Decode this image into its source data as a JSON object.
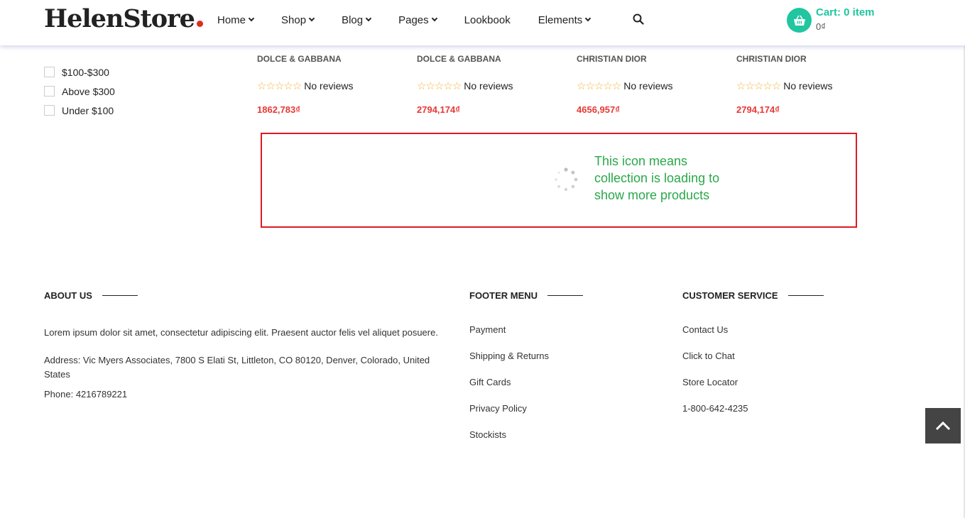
{
  "header": {
    "logo": "HelenStore",
    "nav": [
      {
        "label": "Home",
        "has_dropdown": true
      },
      {
        "label": "Shop",
        "has_dropdown": true
      },
      {
        "label": "Blog",
        "has_dropdown": true
      },
      {
        "label": "Pages",
        "has_dropdown": true
      },
      {
        "label": "Lookbook",
        "has_dropdown": false
      },
      {
        "label": "Elements",
        "has_dropdown": true
      }
    ],
    "search_icon": "search-icon",
    "cart": {
      "label": "Cart: 0 item",
      "total": "0₫",
      "icon": "basket-icon"
    }
  },
  "filters": [
    {
      "label": "$100-$300",
      "checked": false
    },
    {
      "label": "Above $300",
      "checked": false
    },
    {
      "label": "Under $100",
      "checked": false
    }
  ],
  "products": [
    {
      "brand": "DOLCE & GABBANA",
      "stars": "☆☆☆☆☆",
      "reviews": "No reviews",
      "price": "1862,783₫"
    },
    {
      "brand": "DOLCE & GABBANA",
      "stars": "☆☆☆☆☆",
      "reviews": "No reviews",
      "price": "2794,174₫"
    },
    {
      "brand": "CHRISTIAN DIOR",
      "stars": "☆☆☆☆☆",
      "reviews": "No reviews",
      "price": "4656,957₫"
    },
    {
      "brand": "CHRISTIAN DIOR",
      "stars": "☆☆☆☆☆",
      "reviews": "No reviews",
      "price": "2794,174₫"
    }
  ],
  "loading": {
    "annotation": "This icon means collection is loading to show more products",
    "icon": "loading-spinner-icon",
    "highlight_color": "#e01a22",
    "annotation_color": "#2aa84a"
  },
  "footer": {
    "about": {
      "heading": "ABOUT US",
      "text": "Lorem ipsum dolor sit amet, consectetur adipiscing elit. Praesent auctor felis vel aliquet posuere.",
      "address": "Address: Vic Myers Associates, 7800 S Elati St, Littleton, CO 80120, Denver, Colorado, United States",
      "phone": "Phone: 4216789221"
    },
    "menu": {
      "heading": "FOOTER MENU",
      "links": [
        "Payment",
        "Shipping & Returns",
        "Gift Cards",
        "Privacy Policy",
        "Stockists"
      ]
    },
    "service": {
      "heading": "CUSTOMER SERVICE",
      "links": [
        "Contact Us",
        "Click to Chat",
        "Store Locator",
        "1-800-642-4235"
      ]
    }
  },
  "back_to_top_icon": "chevron-up-icon",
  "colors": {
    "accent": "#20c6a0",
    "price": "#e53935",
    "logo_dot": "#e02b20"
  }
}
